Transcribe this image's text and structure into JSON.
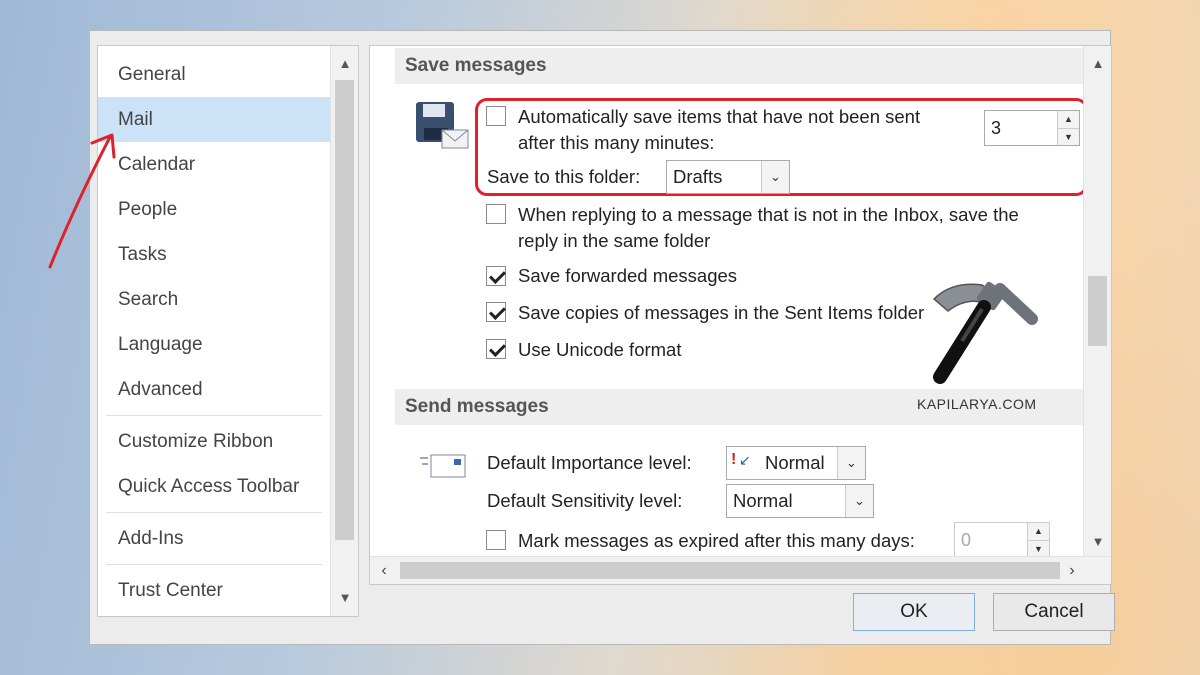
{
  "nav": {
    "items": [
      {
        "label": "General"
      },
      {
        "label": "Mail",
        "selected": true
      },
      {
        "label": "Calendar"
      },
      {
        "label": "People"
      },
      {
        "label": "Tasks"
      },
      {
        "label": "Search"
      },
      {
        "label": "Language"
      },
      {
        "label": "Advanced"
      },
      {
        "label": "Customize Ribbon"
      },
      {
        "label": "Quick Access Toolbar"
      },
      {
        "label": "Add-Ins"
      },
      {
        "label": "Trust Center"
      }
    ]
  },
  "save_messages": {
    "heading": "Save messages",
    "autosave_label_line1": "Automatically save items that have not been sent",
    "autosave_label_line2": "after this many minutes:",
    "autosave_checked": false,
    "minutes_value": "3",
    "save_to_folder_label": "Save to this folder:",
    "folder_value": "Drafts",
    "reply_label_line1": "When replying to a message that is not in the Inbox, save the",
    "reply_label_line2": "reply in the same folder",
    "reply_checked": false,
    "save_forwarded_label": "Save forwarded messages",
    "save_forwarded_checked": true,
    "save_copies_label": "Save copies of messages in the Sent Items folder",
    "save_copies_checked": true,
    "unicode_label": "Use Unicode format",
    "unicode_checked": true
  },
  "send_messages": {
    "heading": "Send messages",
    "importance_label": "Default Importance level:",
    "importance_value": "Normal",
    "sensitivity_label": "Default Sensitivity level:",
    "sensitivity_value": "Normal",
    "expire_label": "Mark messages as expired after this many days:",
    "expire_checked": false,
    "expire_value": "0"
  },
  "footer": {
    "ok_label": "OK",
    "cancel_label": "Cancel"
  },
  "watermark": "KAPILARYA.COM",
  "colors": {
    "highlight": "#e0202a",
    "selected_nav": "#cce2f7"
  }
}
